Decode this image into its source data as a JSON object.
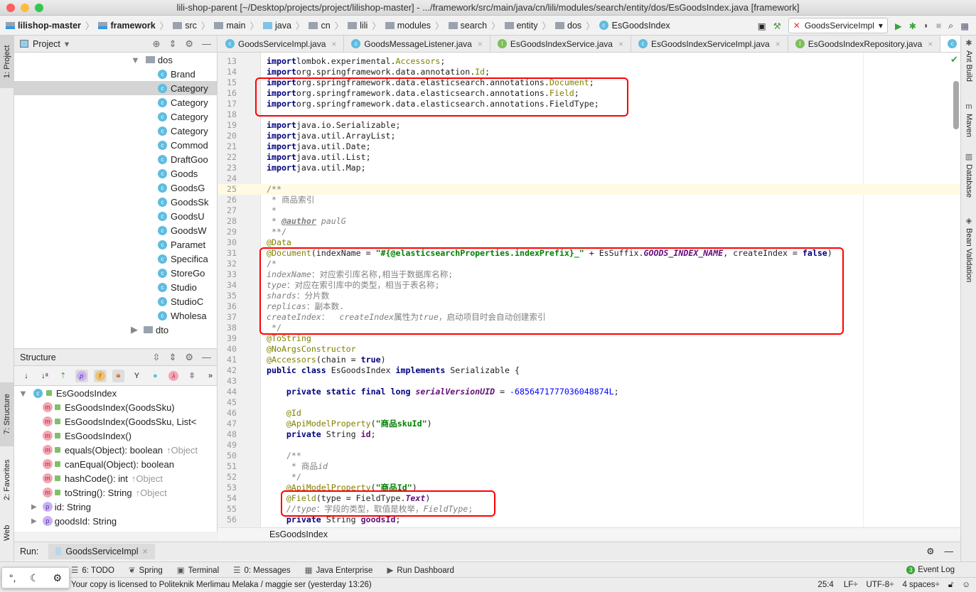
{
  "window": {
    "title": "lili-shop-parent [~/Desktop/projects/project/lilishop-master] - .../framework/src/main/java/cn/lili/modules/search/entity/dos/EsGoodsIndex.java [framework]"
  },
  "breadcrumbs": [
    "lilishop-master",
    "framework",
    "src",
    "main",
    "java",
    "cn",
    "lili",
    "modules",
    "search",
    "entity",
    "dos",
    "EsGoodsIndex"
  ],
  "toolbar": {
    "run_config": "GoodsServiceImpl"
  },
  "left_strip": {
    "project": "1: Project",
    "structure": "7: Structure",
    "favorites": "2: Favorites",
    "web": "Web"
  },
  "right_strip": [
    "Ant Build",
    "Maven",
    "Database",
    "Bean Validation"
  ],
  "project_panel": {
    "title": "Project",
    "folder": "dos",
    "items": [
      "Brand",
      "Category",
      "Category",
      "Category",
      "Category",
      "Commod",
      "DraftGoo",
      "Goods",
      "GoodsG",
      "GoodsSk",
      "GoodsU",
      "GoodsW",
      "Paramet",
      "Specifica",
      "StoreGo",
      "Studio",
      "StudioC",
      "Wholesa"
    ],
    "selected_index": 1,
    "next_folder": "dto"
  },
  "structure_panel": {
    "title": "Structure",
    "root": "EsGoodsIndex",
    "members": [
      {
        "icon": "m",
        "name": "EsGoodsIndex(GoodsSku)",
        "inherit": ""
      },
      {
        "icon": "m",
        "name": "EsGoodsIndex(GoodsSku, List<",
        "inherit": ""
      },
      {
        "icon": "m",
        "name": "EsGoodsIndex()",
        "inherit": ""
      },
      {
        "icon": "m",
        "name": "equals(Object): boolean",
        "inherit": "↑Object"
      },
      {
        "icon": "m",
        "name": "canEqual(Object): boolean",
        "inherit": ""
      },
      {
        "icon": "m",
        "name": "hashCode(): int",
        "inherit": "↑Object"
      },
      {
        "icon": "m",
        "name": "toString(): String",
        "inherit": "↑Object"
      },
      {
        "icon": "p",
        "name": "id: String",
        "inherit": ""
      },
      {
        "icon": "p",
        "name": "goodsId: String",
        "inherit": ""
      }
    ]
  },
  "editor_tabs": [
    {
      "label": "GoodsServiceImpl.java",
      "kind": "c"
    },
    {
      "label": "GoodsMessageListener.java",
      "kind": "c"
    },
    {
      "label": "EsGoodsIndexService.java",
      "kind": "i"
    },
    {
      "label": "EsGoodsIndexServiceImpl.java",
      "kind": "c"
    },
    {
      "label": "EsGoodsIndexRepository.java",
      "kind": "i"
    },
    {
      "label": "EsGoodsIn",
      "kind": "c",
      "active": true
    }
  ],
  "editor": {
    "first_line": 13,
    "caret_line": 25,
    "lines": [
      [
        [
          "kw",
          "import"
        ],
        [
          "",
          "lombok.experimental."
        ],
        [
          "ann",
          "Accessors"
        ],
        [
          "",
          ";"
        ]
      ],
      [
        [
          "kw",
          "import"
        ],
        [
          "",
          "org.springframework.data.annotation."
        ],
        [
          "ann",
          "Id"
        ],
        [
          "",
          ";"
        ]
      ],
      [
        [
          "kw",
          "import"
        ],
        [
          "",
          "org.springframework.data.elasticsearch.annotations."
        ],
        [
          "ann",
          "Document"
        ],
        [
          "",
          ";"
        ]
      ],
      [
        [
          "kw",
          "import"
        ],
        [
          "",
          "org.springframework.data.elasticsearch.annotations."
        ],
        [
          "ann",
          "Field"
        ],
        [
          "",
          ";"
        ]
      ],
      [
        [
          "kw",
          "import"
        ],
        [
          "",
          "org.springframework.data.elasticsearch.annotations.FieldType;"
        ]
      ],
      [],
      [
        [
          "kw",
          "import"
        ],
        [
          "",
          "java.io.Serializable;"
        ]
      ],
      [
        [
          "kw",
          "import"
        ],
        [
          "",
          "java.util.ArrayList;"
        ]
      ],
      [
        [
          "kw",
          "import"
        ],
        [
          "",
          "java.util.Date;"
        ]
      ],
      [
        [
          "kw",
          "import"
        ],
        [
          "",
          "java.util.List;"
        ]
      ],
      [
        [
          "kw",
          "import"
        ],
        [
          "",
          "java.util.Map;"
        ]
      ],
      [],
      [
        [
          "cm",
          "/**"
        ]
      ],
      [
        [
          "cm",
          " * 商品索引"
        ]
      ],
      [
        [
          "cm",
          " *"
        ]
      ],
      [
        [
          "cm",
          " * "
        ],
        [
          "doc",
          "@author"
        ],
        [
          "cmi",
          " paulG"
        ]
      ],
      [
        [
          "cm",
          " **/"
        ]
      ],
      [
        [
          "ann",
          "@Data"
        ]
      ],
      [
        [
          "ann",
          "@Document"
        ],
        [
          "",
          "(indexName = "
        ],
        [
          "str",
          "\"#{@elasticsearchProperties.indexPrefix}_\""
        ],
        [
          "",
          " + EsSuffix."
        ],
        [
          "fld",
          "GOODS_INDEX_NAME"
        ],
        [
          "",
          ", createIndex = "
        ],
        [
          "kw",
          "false"
        ],
        [
          "",
          ")"
        ]
      ],
      [
        [
          "cm",
          "/*"
        ]
      ],
      [
        [
          "cmi",
          "indexName"
        ],
        [
          "cm",
          "：对应索引库名称,相当于数据库名称;"
        ]
      ],
      [
        [
          "cmi",
          "type"
        ],
        [
          "cm",
          "：对应在索引库中的类型，相当于表名称;"
        ]
      ],
      [
        [
          "cmi",
          "shards"
        ],
        [
          "cm",
          "：分片数"
        ]
      ],
      [
        [
          "cmi",
          "replicas"
        ],
        [
          "cm",
          "：副本数."
        ]
      ],
      [
        [
          "cmi",
          "createIndex"
        ],
        [
          "cm",
          "：  "
        ],
        [
          "cmi",
          "createIndex"
        ],
        [
          "cm",
          "属性为"
        ],
        [
          "cmi",
          "true"
        ],
        [
          "cm",
          "，启动项目时会自动创建索引"
        ]
      ],
      [
        [
          "cm",
          " */"
        ]
      ],
      [
        [
          "ann",
          "@ToString"
        ]
      ],
      [
        [
          "ann",
          "@NoArgsConstructor"
        ]
      ],
      [
        [
          "ann",
          "@Accessors"
        ],
        [
          "",
          "(chain = "
        ],
        [
          "kw",
          "true"
        ],
        [
          "",
          ")"
        ]
      ],
      [
        [
          "kw",
          "public class "
        ],
        [
          "",
          "EsGoodsIndex "
        ],
        [
          "kw",
          "implements "
        ],
        [
          "",
          "Serializable {"
        ]
      ],
      [],
      [
        [
          "",
          "    "
        ],
        [
          "kw",
          "private static final long "
        ],
        [
          "fld",
          "serialVersionUID"
        ],
        [
          "",
          " = "
        ],
        [
          "num",
          "-6856471777036048874L"
        ],
        [
          "",
          ";"
        ]
      ],
      [],
      [
        [
          "",
          "    "
        ],
        [
          "ann",
          "@Id"
        ]
      ],
      [
        [
          "",
          "    "
        ],
        [
          "ann",
          "@ApiModelProperty"
        ],
        [
          "",
          "("
        ],
        [
          "str",
          "\"商品skuId\""
        ],
        [
          "",
          ")"
        ]
      ],
      [
        [
          "",
          "    "
        ],
        [
          "kw",
          "private "
        ],
        [
          "",
          "String "
        ],
        [
          "fldb",
          "id"
        ],
        [
          "",
          ";"
        ]
      ],
      [],
      [
        [
          "cm",
          "    /**"
        ]
      ],
      [
        [
          "cm",
          "     * 商品"
        ],
        [
          "cmi",
          "id"
        ]
      ],
      [
        [
          "cm",
          "     */"
        ]
      ],
      [
        [
          "",
          "    "
        ],
        [
          "ann",
          "@ApiModelProperty"
        ],
        [
          "",
          "("
        ],
        [
          "str",
          "\"商品Id\""
        ],
        [
          "",
          ")"
        ]
      ],
      [
        [
          "",
          "    "
        ],
        [
          "ann",
          "@Field"
        ],
        [
          "",
          "(type = FieldType."
        ],
        [
          "fld",
          "Text"
        ],
        [
          "",
          ")"
        ]
      ],
      [
        [
          "cmi",
          "    //type"
        ],
        [
          "cm",
          "：字段的类型，取值是枚举，"
        ],
        [
          "cmi",
          "FieldType"
        ],
        [
          "cm",
          ";"
        ]
      ],
      [
        [
          "",
          "    "
        ],
        [
          "kw",
          "private "
        ],
        [
          "",
          "String "
        ],
        [
          "fldb",
          "goodsId"
        ],
        [
          "",
          ";"
        ]
      ]
    ]
  },
  "editor_breadcrumb": "EsGoodsIndex",
  "run": {
    "label": "Run:",
    "config": "GoodsServiceImpl"
  },
  "tool_windows": [
    "6: TODO",
    "Spring",
    "Terminal",
    "0: Messages",
    "Java Enterprise",
    "Run Dashboard"
  ],
  "event_log": {
    "count": "3",
    "label": "Event Log"
  },
  "status": {
    "message": "Your copy is licensed to Politeknik Merlimau Melaka / maggie ser (yesterday 13:26)",
    "position": "25:4",
    "line_sep": "LF",
    "encoding": "UTF-8",
    "indent": "4 spaces"
  },
  "colors": {
    "highlight_box": "#ff0000",
    "keyword": "#000080",
    "annotation": "#808000",
    "string": "#008000",
    "number": "#0000ff",
    "field": "#660e7a",
    "comment": "#808080"
  }
}
